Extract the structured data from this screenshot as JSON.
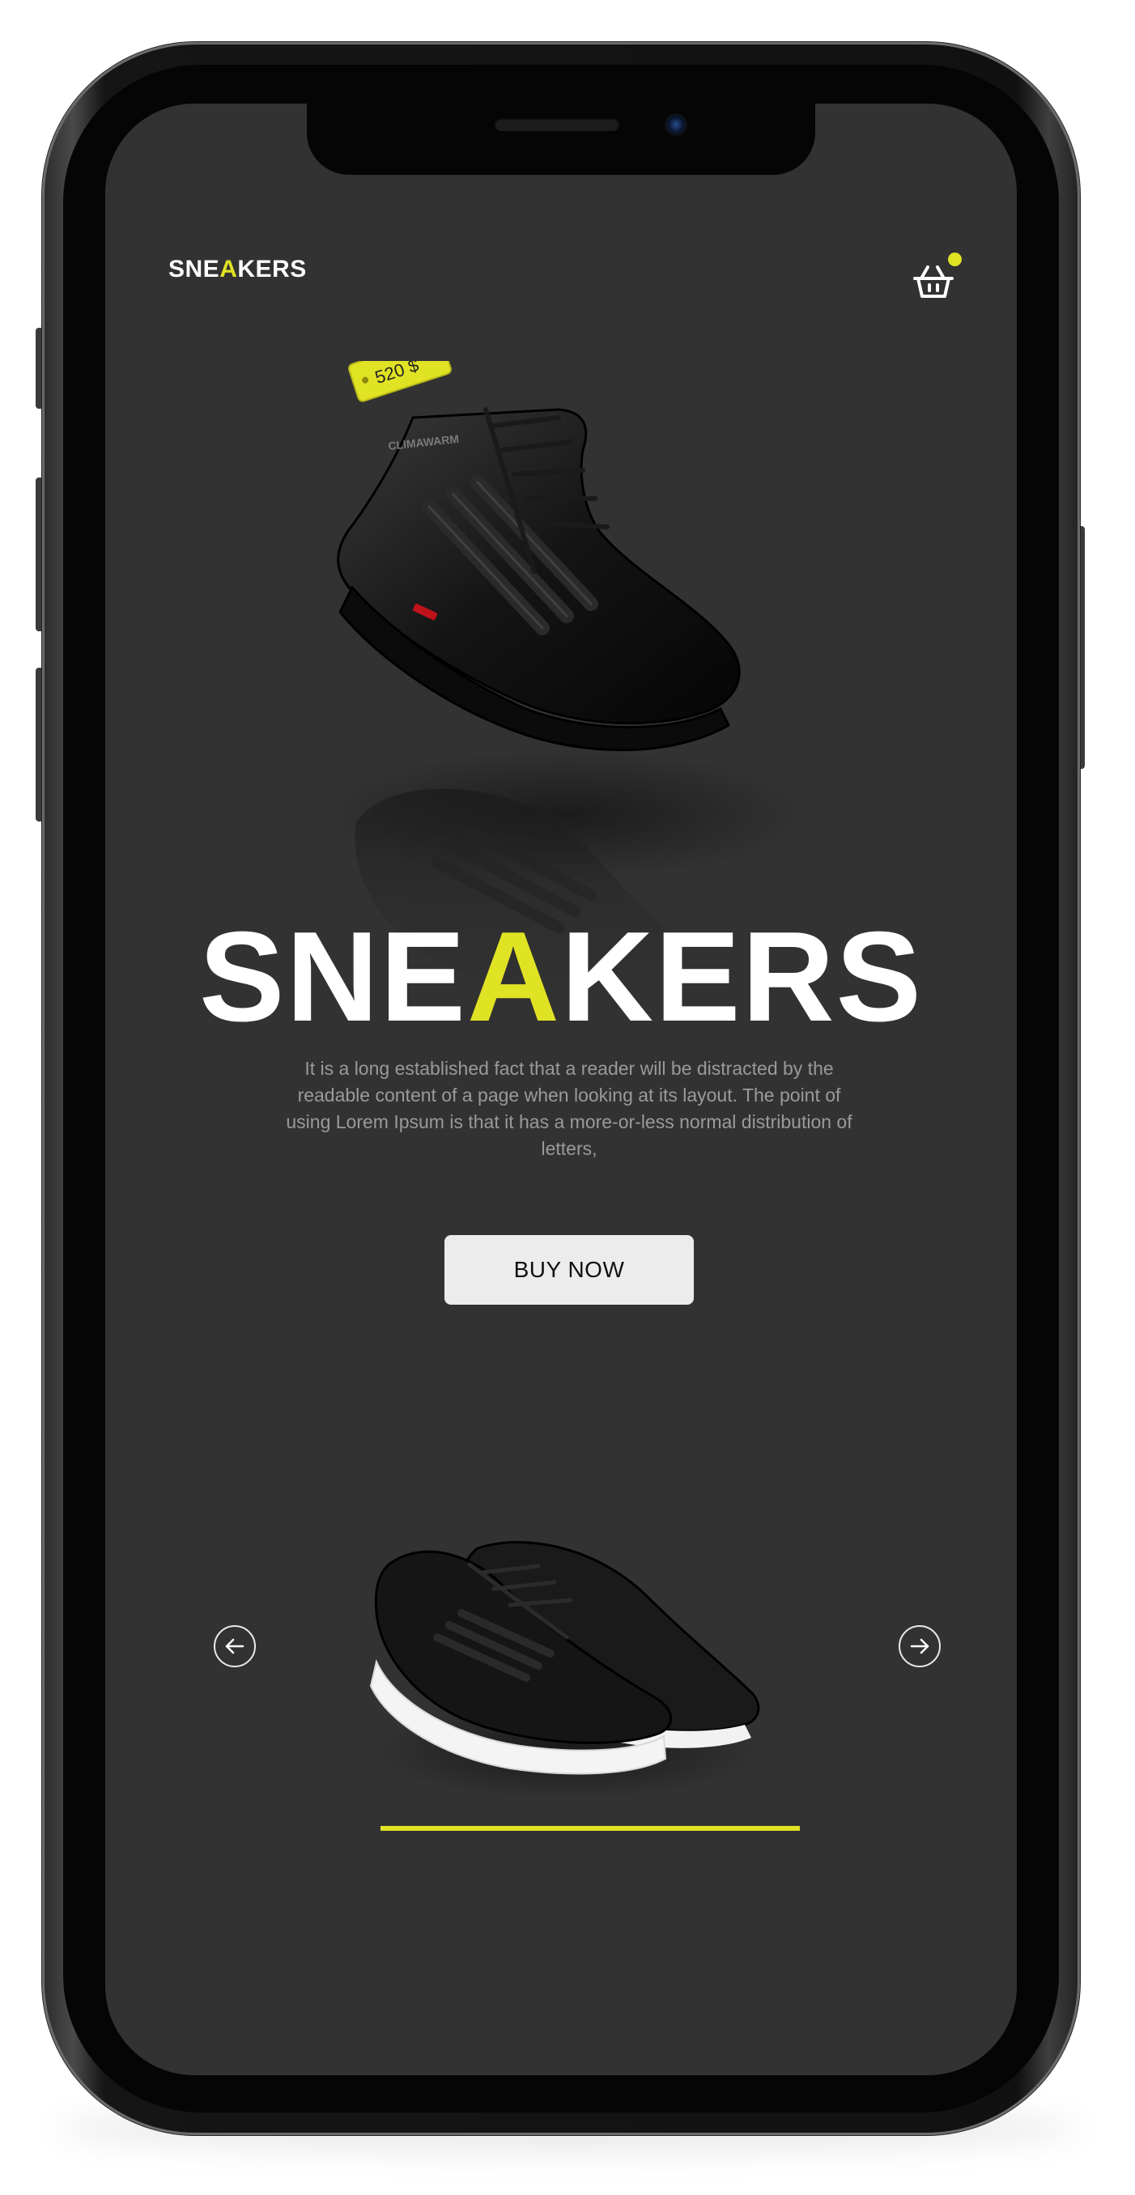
{
  "header": {
    "logo_pre": "SNE",
    "logo_accent": "A",
    "logo_post": "KERS",
    "cart_icon": "basket-icon",
    "cart_badge_visible": true
  },
  "hero": {
    "price_tag": "520 $",
    "shoe_brand_text": "CLIMAWARM",
    "title_pre": "SNE",
    "title_accent": "A",
    "title_post": "KERS",
    "description": "It is a long established fact that a reader will be distracted by the readable content of a page when looking at its layout. The point of using Lorem Ipsum is that it has a more-or-less normal distribution of letters,",
    "buy_label": "BUY NOW"
  },
  "carousel": {
    "prev_icon": "arrow-left-icon",
    "next_icon": "arrow-right-icon",
    "progress": 1.0
  },
  "colors": {
    "accent": "#e0e224",
    "screen_bg": "#323232",
    "button_bg": "#ececec",
    "text_primary": "#ffffff",
    "text_secondary": "#9a9a9a"
  }
}
